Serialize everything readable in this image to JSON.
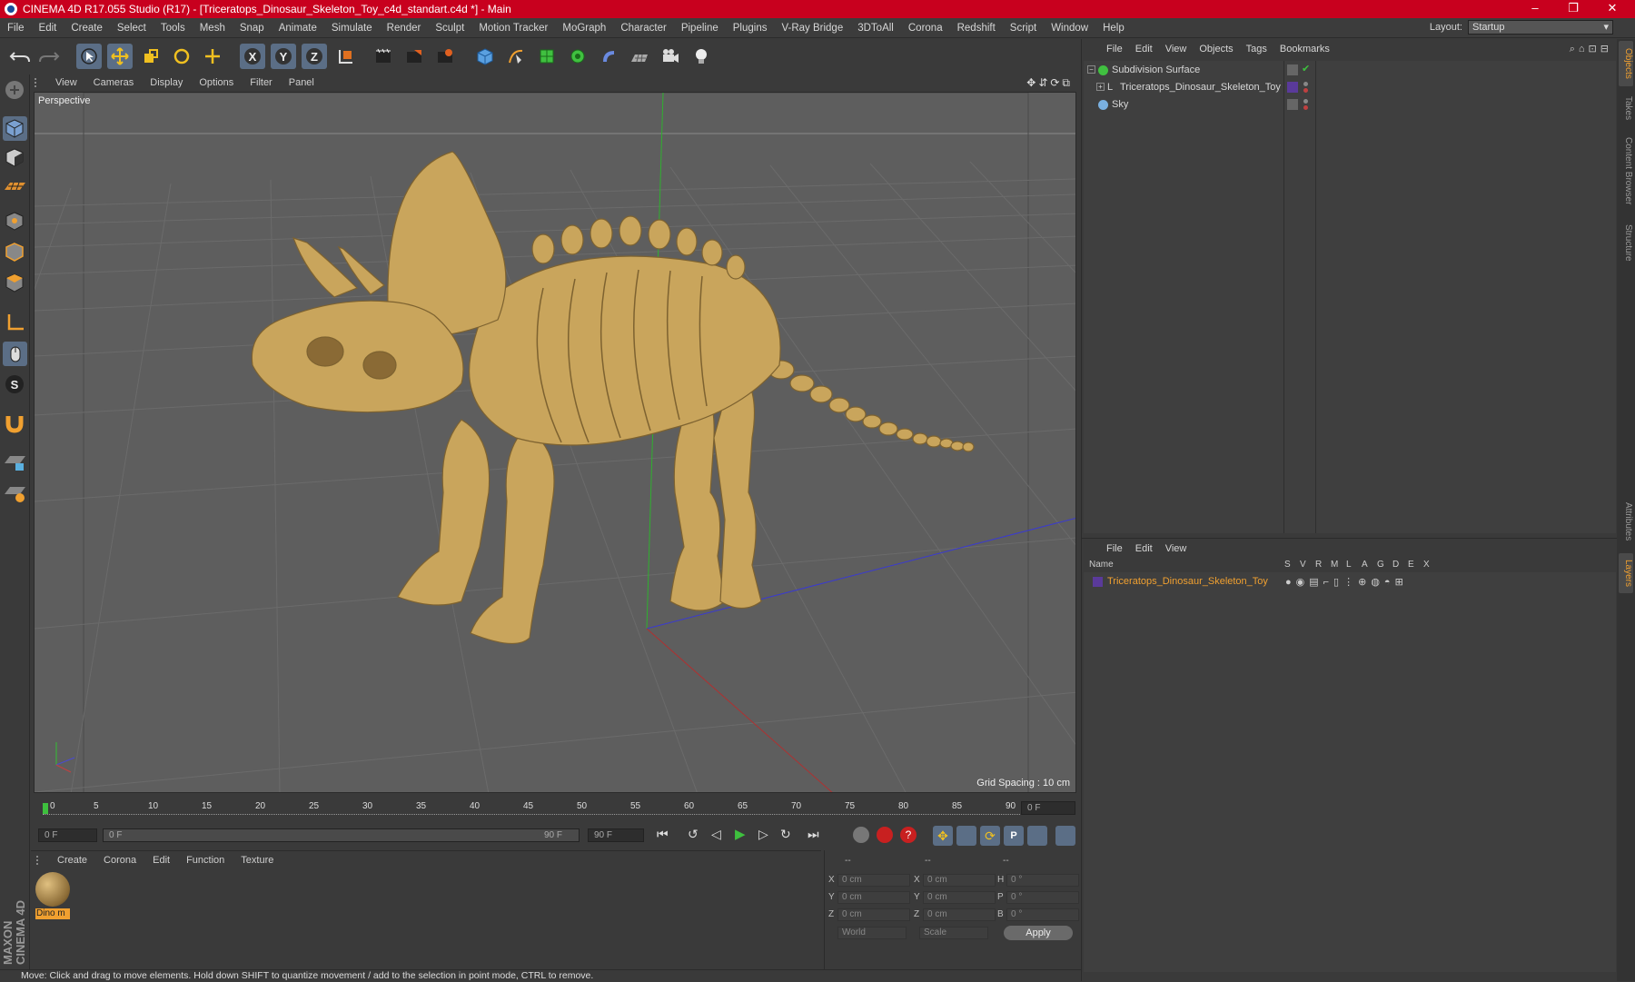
{
  "window": {
    "title": "CINEMA 4D R17.055 Studio (R17) - [Triceratops_Dinosaur_Skeleton_Toy_c4d_standart.c4d *] - Main",
    "minimize": "–",
    "maximize": "❐",
    "close": "✕"
  },
  "menu": [
    "File",
    "Edit",
    "Create",
    "Select",
    "Tools",
    "Mesh",
    "Snap",
    "Animate",
    "Simulate",
    "Render",
    "Sculpt",
    "Motion Tracker",
    "MoGraph",
    "Character",
    "Pipeline",
    "Plugins",
    "V-Ray Bridge",
    "3DToAll",
    "Corona",
    "Redshift",
    "Script",
    "Window",
    "Help"
  ],
  "layout": {
    "label": "Layout:",
    "value": "Startup"
  },
  "viewport": {
    "menu": [
      "View",
      "Cameras",
      "Display",
      "Options",
      "Filter",
      "Panel"
    ],
    "label": "Perspective",
    "grid_spacing": "Grid Spacing : 10 cm"
  },
  "timeline": {
    "ticks": [
      "0",
      "5",
      "10",
      "15",
      "20",
      "25",
      "30",
      "35",
      "40",
      "45",
      "50",
      "55",
      "60",
      "65",
      "70",
      "75",
      "80",
      "85",
      "90"
    ],
    "current_frame": "0 F",
    "start_field": "0 F",
    "slider_left": "0 F",
    "slider_right": "90 F",
    "end_field": "90 F"
  },
  "material": {
    "menu": [
      "Create",
      "Corona",
      "Edit",
      "Function",
      "Texture"
    ],
    "items": [
      {
        "name": "Dino m"
      }
    ]
  },
  "coords": {
    "header": [
      "--",
      "--",
      "--"
    ],
    "rows": [
      {
        "a": "X",
        "av": "0 cm",
        "b": "X",
        "bv": "0 cm",
        "c": "H",
        "cv": "0 °"
      },
      {
        "a": "Y",
        "av": "0 cm",
        "b": "Y",
        "bv": "0 cm",
        "c": "P",
        "cv": "0 °"
      },
      {
        "a": "Z",
        "av": "0 cm",
        "b": "Z",
        "bv": "0 cm",
        "c": "B",
        "cv": "0 °"
      }
    ],
    "mode1": "World",
    "mode2": "Scale",
    "apply": "Apply"
  },
  "status": "Move: Click and drag to move elements. Hold down SHIFT to quantize movement / add to the selection in point mode, CTRL to remove.",
  "objects": {
    "menu": [
      "File",
      "Edit",
      "View",
      "Objects",
      "Tags",
      "Bookmarks"
    ],
    "items": [
      {
        "name": "Subdivision Surface"
      },
      {
        "name": "Triceratops_Dinosaur_Skeleton_Toy"
      },
      {
        "name": "Sky"
      }
    ]
  },
  "layers": {
    "menu": [
      "File",
      "Edit",
      "View"
    ],
    "columns": [
      "Name",
      "S",
      "V",
      "R",
      "M",
      "L",
      "A",
      "G",
      "D",
      "E",
      "X"
    ],
    "items": [
      {
        "name": "Triceratops_Dinosaur_Skeleton_Toy"
      }
    ]
  },
  "side_tabs": [
    "Objects",
    "Takes",
    "Content Browser",
    "Structure",
    "Attributes",
    "Layers"
  ],
  "brand": "MAXON CINEMA 4D",
  "colors": {
    "titlebar": "#c8001e",
    "accent_orange": "#f0a030",
    "selected_tool": "#5b6e86",
    "bone": "#c9a55c"
  }
}
